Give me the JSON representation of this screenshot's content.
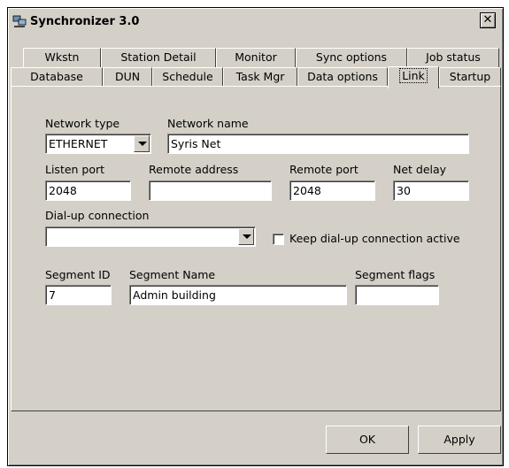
{
  "window": {
    "title": "Synchronizer 3.0",
    "close_glyph": "✕"
  },
  "tabs_row1": [
    "Wkstn",
    "Station Detail",
    "Monitor",
    "Sync options",
    "Job status"
  ],
  "tabs_row2": [
    "Database",
    "DUN",
    "Schedule",
    "Task Mgr",
    "Data options",
    "Link",
    "Startup"
  ],
  "active_tab": "Link",
  "form": {
    "network_type_label": "Network type",
    "network_type_value": "ETHERNET",
    "network_name_label": "Network name",
    "network_name_value": "Syris Net",
    "listen_port_label": "Listen port",
    "listen_port_value": "2048",
    "remote_address_label": "Remote address",
    "remote_address_value": "",
    "remote_port_label": "Remote port",
    "remote_port_value": "2048",
    "net_delay_label": "Net delay",
    "net_delay_value": "30",
    "dialup_label": "Dial-up connection",
    "dialup_value": "",
    "keep_dialup_label": "Keep dial-up connection active",
    "keep_dialup_checked": false,
    "segment_id_label": "Segment ID",
    "segment_id_value": "7",
    "segment_name_label": "Segment Name",
    "segment_name_value": "Admin building",
    "segment_flags_label": "Segment flags",
    "segment_flags_value": ""
  },
  "buttons": {
    "ok": "OK",
    "apply": "Apply"
  }
}
